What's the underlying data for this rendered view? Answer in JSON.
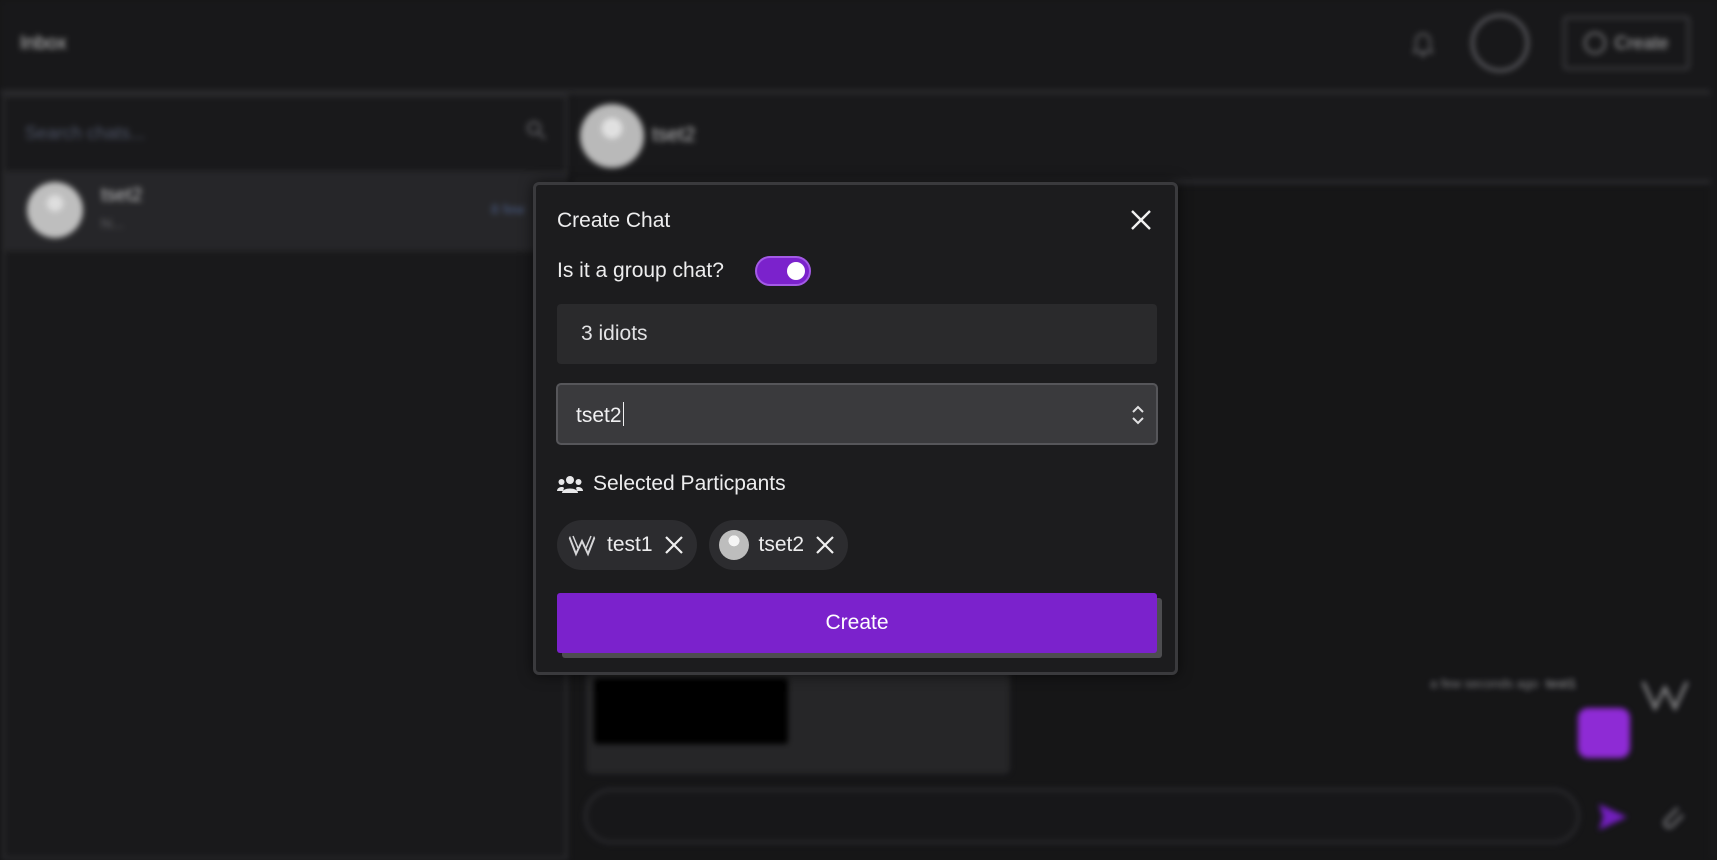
{
  "app": {
    "header": {
      "title": "Inbox",
      "create_label": "Create"
    },
    "sidebar": {
      "search_placeholder": "Search chats...",
      "items": [
        {
          "name": "tset2",
          "preview": "hi...",
          "time": "8 few"
        }
      ]
    },
    "chat": {
      "partner_name": "tset2",
      "message_meta": "a few seconds ago",
      "message_sender": "test1"
    }
  },
  "modal": {
    "title": "Create Chat",
    "group_toggle_label": "Is it a group chat?",
    "group_toggle_on": true,
    "chat_name_value": "3 idiots",
    "participant_search_value": "tset2",
    "selected_header": "Selected Particpants",
    "selected": [
      {
        "name": "test1",
        "avatar": "w-logo-icon"
      },
      {
        "name": "tset2",
        "avatar": "user-avatar-icon"
      }
    ],
    "create_label": "Create"
  },
  "colors": {
    "accent": "#7b22cc",
    "background": "#18181a",
    "surface": "#2a2a2c"
  }
}
